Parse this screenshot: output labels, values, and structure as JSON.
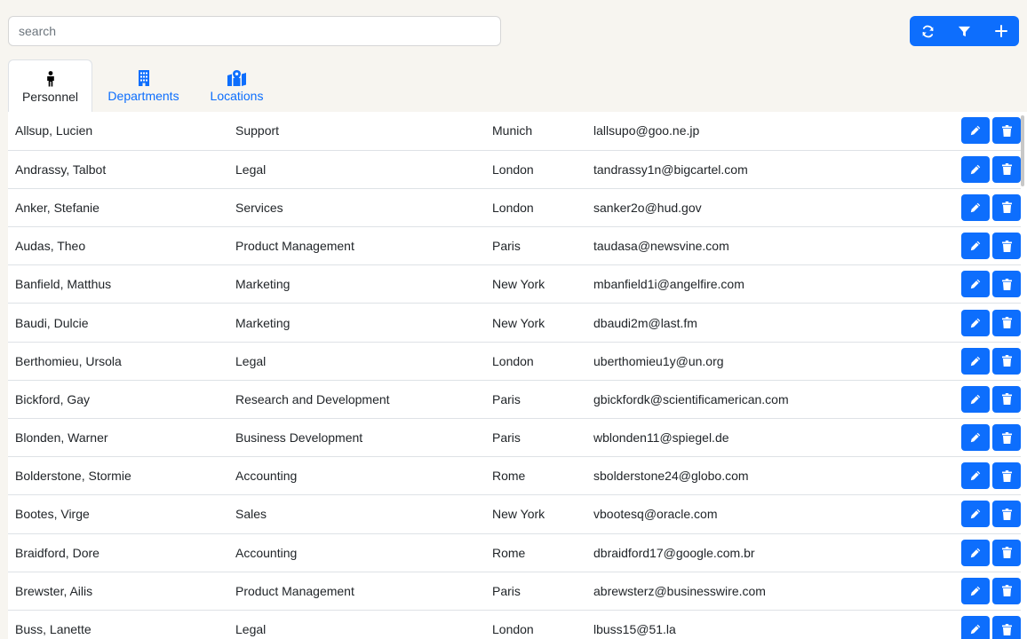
{
  "search": {
    "placeholder": "search",
    "value": ""
  },
  "toolbar": {
    "buttons": [
      {
        "icon": "refresh-icon"
      },
      {
        "icon": "filter-icon"
      },
      {
        "icon": "plus-icon"
      }
    ]
  },
  "tabs": [
    {
      "label": "Personnel",
      "icon": "person-icon",
      "active": true
    },
    {
      "label": "Departments",
      "icon": "building-icon",
      "active": false
    },
    {
      "label": "Locations",
      "icon": "map-location-icon",
      "active": false
    }
  ],
  "table": {
    "rows": [
      {
        "name": "Allsup, Lucien",
        "department": "Support",
        "location": "Munich",
        "email": "lallsupo@goo.ne.jp"
      },
      {
        "name": "Andrassy, Talbot",
        "department": "Legal",
        "location": "London",
        "email": "tandrassy1n@bigcartel.com"
      },
      {
        "name": "Anker, Stefanie",
        "department": "Services",
        "location": "London",
        "email": "sanker2o@hud.gov"
      },
      {
        "name": "Audas, Theo",
        "department": "Product Management",
        "location": "Paris",
        "email": "taudasa@newsvine.com"
      },
      {
        "name": "Banfield, Matthus",
        "department": "Marketing",
        "location": "New York",
        "email": "mbanfield1i@angelfire.com"
      },
      {
        "name": "Baudi, Dulcie",
        "department": "Marketing",
        "location": "New York",
        "email": "dbaudi2m@last.fm"
      },
      {
        "name": "Berthomieu, Ursola",
        "department": "Legal",
        "location": "London",
        "email": "uberthomieu1y@un.org"
      },
      {
        "name": "Bickford, Gay",
        "department": "Research and Development",
        "location": "Paris",
        "email": "gbickfordk@scientificamerican.com"
      },
      {
        "name": "Blonden, Warner",
        "department": "Business Development",
        "location": "Paris",
        "email": "wblonden11@spiegel.de"
      },
      {
        "name": "Bolderstone, Stormie",
        "department": "Accounting",
        "location": "Rome",
        "email": "sbolderstone24@globo.com"
      },
      {
        "name": "Bootes, Virge",
        "department": "Sales",
        "location": "New York",
        "email": "vbootesq@oracle.com"
      },
      {
        "name": "Braidford, Dore",
        "department": "Accounting",
        "location": "Rome",
        "email": "dbraidford17@google.com.br"
      },
      {
        "name": "Brewster, Ailis",
        "department": "Product Management",
        "location": "Paris",
        "email": "abrewsterz@businesswire.com"
      },
      {
        "name": "Buss, Lanette",
        "department": "Legal",
        "location": "London",
        "email": "lbuss15@51.la"
      }
    ]
  },
  "colors": {
    "primary": "#0d6efd",
    "background": "#f7f5f0",
    "border": "#dee2e6",
    "text": "#212529"
  }
}
